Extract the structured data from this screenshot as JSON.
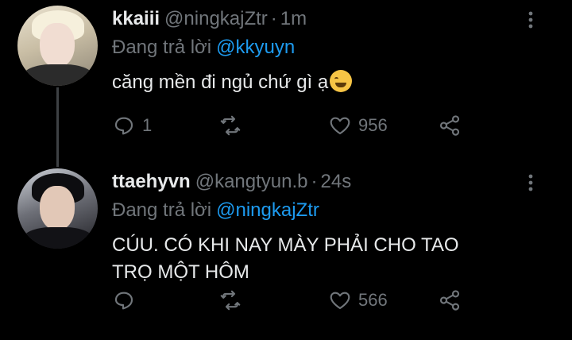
{
  "tweets": [
    {
      "display_name": "kkaiii",
      "handle": "@ningkajZtr",
      "time": "1m",
      "reply_prefix": "Đang trả lời",
      "reply_to": "@kkyuyn",
      "text": "căng mền đi ngủ chứ gì ạ",
      "emoji": "grinning-sweat-emoji",
      "reply_count": "1",
      "retweet_count": "",
      "like_count": "956"
    },
    {
      "display_name": "ttaehyvn",
      "handle": "@kangtyun.b",
      "time": "24s",
      "reply_prefix": "Đang trả lời",
      "reply_to": "@ningkajZtr",
      "text_line1": "CÚU. CÓ KHI NAY MÀY PHẢI CHO TAO",
      "text_line2": "TRỌ MỘT HÔM",
      "reply_count": "",
      "retweet_count": "",
      "like_count": "566"
    }
  ],
  "icons": {
    "reply": "reply-icon",
    "retweet": "retweet-icon",
    "like": "heart-icon",
    "share": "share-icon",
    "more": "more-icon"
  },
  "colors": {
    "background": "#000000",
    "text": "#e7e9ea",
    "muted": "#71767b",
    "link": "#1d9bf0"
  }
}
